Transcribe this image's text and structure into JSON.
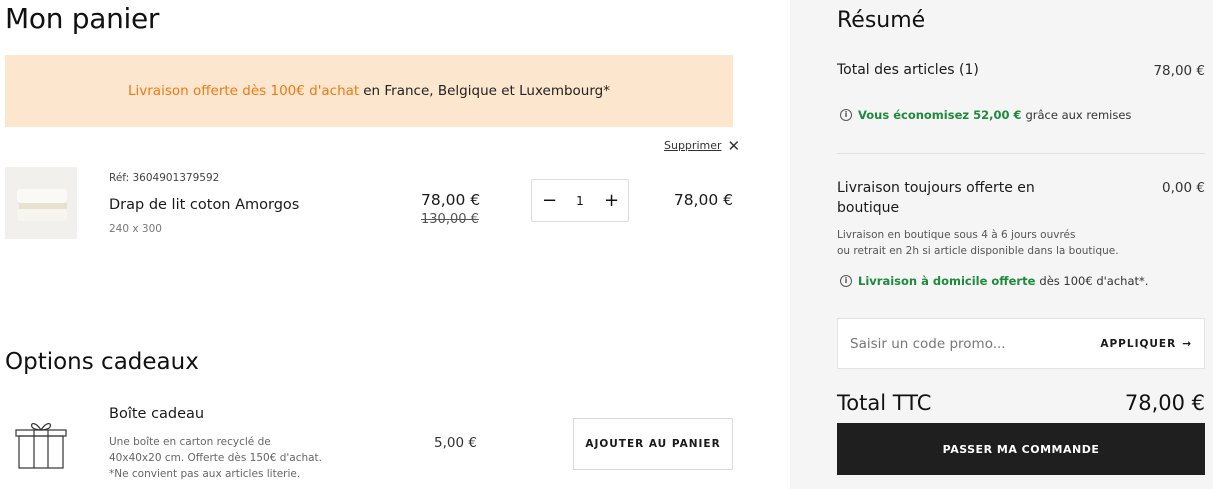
{
  "cart": {
    "title": "Mon panier",
    "banner": {
      "accent": "Livraison offerte dès 100€ d'achat",
      "rest": "en France, Belgique et Luxembourg*"
    },
    "remove_label": "Supprimer",
    "remove_icon": "close-icon",
    "item": {
      "ref": "Réf: 3604901379592",
      "name": "Drap de lit coton Amorgos",
      "dimensions": "240 x 300",
      "price": "78,00 €",
      "old_price": "130,00 €",
      "quantity": "1",
      "minus": "−",
      "plus": "+",
      "line_total": "78,00 €"
    }
  },
  "gift_options": {
    "title": "Options cadeaux",
    "icon": "gift-box-icon",
    "name": "Boîte cadeau",
    "desc_line1": "Une boîte en carton recyclé de",
    "desc_line2": "40x40x20 cm. Offerte dès 150€ d'achat.",
    "desc_line3": "*Ne convient pas aux articles literie.",
    "price": "5,00 €",
    "add_label": "AJOUTER AU PANIER"
  },
  "summary": {
    "title": "Résumé",
    "items_label": "Total des articles (1)",
    "items_value": "78,00 €",
    "savings_green": "Vous économisez 52,00 €",
    "savings_rest": "grâce aux remises",
    "shipping_label": "Livraison toujours offerte en boutique",
    "shipping_value": "0,00 €",
    "shipping_desc_1": "Livraison en boutique sous 4 à 6 jours ouvrés",
    "shipping_desc_2": "ou retrait en 2h si article disponible dans la boutique.",
    "home_green": "Livraison à domicile offerte",
    "home_rest": "dès 100€ d'achat*.",
    "promo_placeholder": "Saisir un code promo...",
    "apply_label": "APPLIQUER",
    "apply_arrow": "→",
    "total_label": "Total TTC",
    "total_value": "78,00 €",
    "checkout_label": "PASSER MA COMMANDE",
    "info_glyph": "i"
  },
  "colors": {
    "banner_bg": "#fde6ce",
    "banner_accent": "#ea7a15",
    "savings_green": "#1e8a3c",
    "checkout_bg": "#1f1f1f"
  }
}
